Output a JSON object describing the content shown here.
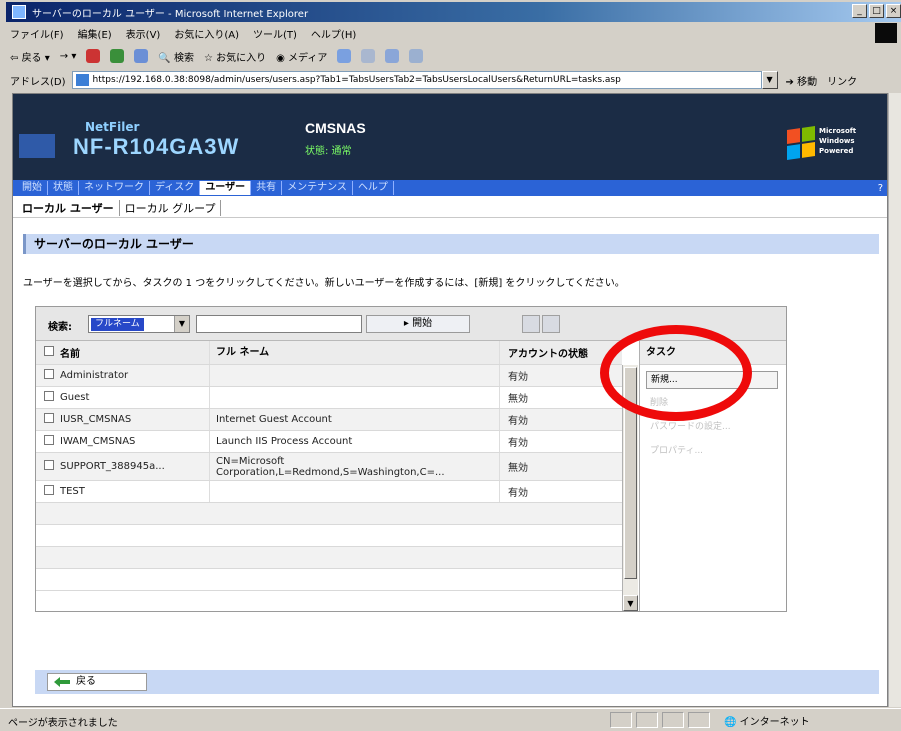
{
  "window": {
    "title": "サーバーのローカル ユーザー - Microsoft Internet Explorer",
    "controls": [
      "_",
      "□",
      "×"
    ]
  },
  "menubar": {
    "items": [
      "ファイル(F)",
      "編集(E)",
      "表示(V)",
      "お気に入り(A)",
      "ツール(T)",
      "ヘルプ(H)"
    ]
  },
  "toolbar": {
    "back": "戻る",
    "search": "検索",
    "favorites": "お気に入り",
    "media": "メディア"
  },
  "address": {
    "label": "アドレス(D)",
    "url": "https://192.168.0.38:8098/admin/users/users.asp?Tab1=TabsUsersTab2=TabsUsersLocalUsers&ReturnURL=tasks.asp",
    "go": "移動",
    "links": "リンク"
  },
  "header": {
    "brand": "NetFiler",
    "model": "NF-R104GA3W",
    "server_name": "CMSNAS",
    "status": "状態: 通常",
    "win_text_1": "Microsoft",
    "win_text_2": "Windows",
    "win_text_3": "Powered"
  },
  "nav": {
    "items": [
      "開始",
      "状態",
      "ネットワーク",
      "ディスク",
      "ユーザー",
      "共有",
      "メンテナンス",
      "ヘルプ"
    ],
    "active_index": 4,
    "end_marker": "?"
  },
  "subtabs": {
    "items": [
      "ローカル ユーザー",
      "ローカル グループ"
    ],
    "active_index": 0
  },
  "section": {
    "title": "サーバーのローカル ユーザー",
    "instruction": "ユーザーを選択してから、タスクの 1 つをクリックしてください。新しいユーザーを作成するには、[新規] をクリックしてください。"
  },
  "filter": {
    "label": "検索:",
    "field_value": "フルネーム",
    "text_value": "",
    "start_button": "▸ 開始"
  },
  "table": {
    "columns": [
      "名前",
      "フル ネーム",
      "アカウントの状態"
    ],
    "rows": [
      {
        "name": "Administrator",
        "full_name": "",
        "state": "有効"
      },
      {
        "name": "Guest",
        "full_name": "",
        "state": "無効"
      },
      {
        "name": "IUSR_CMSNAS",
        "full_name": "Internet Guest Account",
        "state": "有効"
      },
      {
        "name": "IWAM_CMSNAS",
        "full_name": "Launch IIS Process Account",
        "state": "有効"
      },
      {
        "name": "SUPPORT_388945a...",
        "full_name": "CN=Microsoft Corporation,L=Redmond,S=Washington,C=...",
        "state": "無効"
      },
      {
        "name": "TEST",
        "full_name": "",
        "state": "有効"
      }
    ]
  },
  "tasks": {
    "header": "タスク",
    "items": [
      "新規...",
      "削除",
      "パスワードの設定...",
      "プロパティ..."
    ]
  },
  "back_button": "戻る",
  "statusbar": {
    "text": "ページが表示されました",
    "zone": "インターネット"
  },
  "colors": {
    "highlight": "#ee0a0a",
    "nav_bar": "#2b63d6",
    "header_bg": "#1b2c45",
    "section_bg": "#c8d8f4"
  }
}
